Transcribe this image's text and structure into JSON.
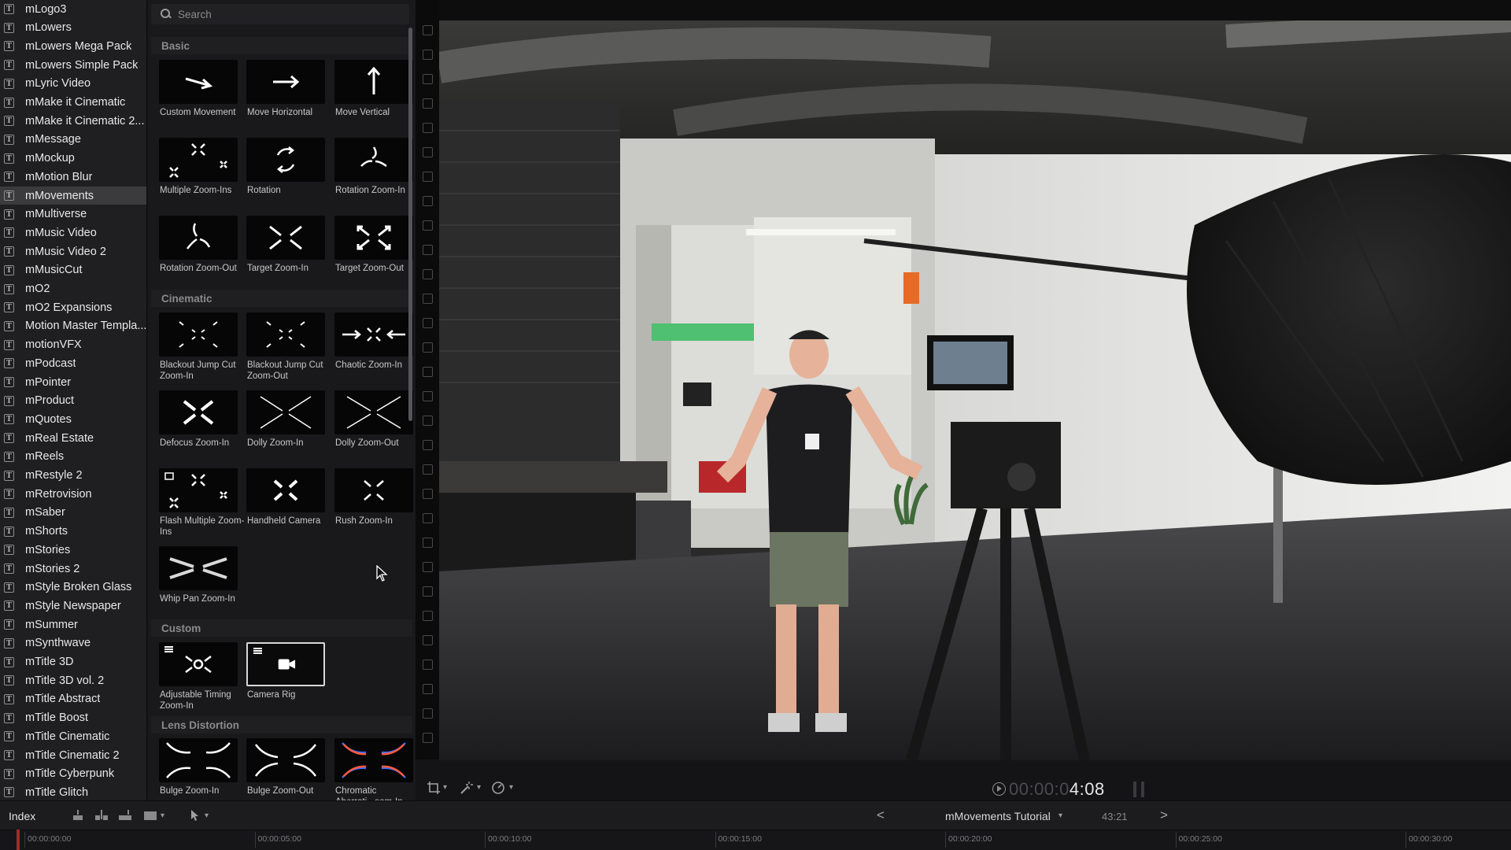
{
  "library": {
    "items": [
      {
        "label": "mLogo3"
      },
      {
        "label": "mLowers"
      },
      {
        "label": "mLowers Mega Pack"
      },
      {
        "label": "mLowers Simple Pack"
      },
      {
        "label": "mLyric Video"
      },
      {
        "label": "mMake it Cinematic"
      },
      {
        "label": "mMake it Cinematic 2..."
      },
      {
        "label": "mMessage"
      },
      {
        "label": "mMockup"
      },
      {
        "label": "mMotion Blur"
      },
      {
        "label": "mMovements"
      },
      {
        "label": "mMultiverse"
      },
      {
        "label": "mMusic Video"
      },
      {
        "label": "mMusic Video 2"
      },
      {
        "label": "mMusicCut"
      },
      {
        "label": "mO2"
      },
      {
        "label": "mO2 Expansions"
      },
      {
        "label": "Motion Master Templa..."
      },
      {
        "label": "motionVFX"
      },
      {
        "label": "mPodcast"
      },
      {
        "label": "mPointer"
      },
      {
        "label": "mProduct"
      },
      {
        "label": "mQuotes"
      },
      {
        "label": "mReal Estate"
      },
      {
        "label": "mReels"
      },
      {
        "label": "mRestyle 2"
      },
      {
        "label": "mRetrovision"
      },
      {
        "label": "mSaber"
      },
      {
        "label": "mShorts"
      },
      {
        "label": "mStories"
      },
      {
        "label": "mStories 2"
      },
      {
        "label": "mStyle Broken Glass"
      },
      {
        "label": "mStyle Newspaper"
      },
      {
        "label": "mSummer"
      },
      {
        "label": "mSynthwave"
      },
      {
        "label": "mTitle 3D"
      },
      {
        "label": "mTitle 3D vol. 2"
      },
      {
        "label": "mTitle Abstract"
      },
      {
        "label": "mTitle Boost"
      },
      {
        "label": "mTitle Cinematic"
      },
      {
        "label": "mTitle Cinematic 2"
      },
      {
        "label": "mTitle Cyberpunk"
      },
      {
        "label": "mTitle Glitch"
      }
    ],
    "selected": "mMovements"
  },
  "search": {
    "placeholder": "Search"
  },
  "sections": {
    "basic": "Basic",
    "cinematic": "Cinematic",
    "custom": "Custom",
    "lens_distortion": "Lens Distortion"
  },
  "tiles": {
    "custom_movement": "Custom Movement",
    "move_horizontal": "Move Horizontal",
    "move_vertical": "Move Vertical",
    "multiple_zoom_ins": "Multiple Zoom-Ins",
    "rotation": "Rotation",
    "rotation_zoom_in": "Rotation Zoom-In",
    "rotation_zoom_out": "Rotation Zoom-Out",
    "target_zoom_in": "Target Zoom-In",
    "target_zoom_out": "Target Zoom-Out",
    "blackout_jump_in": "Blackout Jump Cut Zoom-In",
    "blackout_jump_out": "Blackout Jump Cut Zoom-Out",
    "chaotic_zoom_in": "Chaotic Zoom-In",
    "defocus_zoom_in": "Defocus Zoom-In",
    "dolly_zoom_in": "Dolly Zoom-In",
    "dolly_zoom_out": "Dolly Zoom-Out",
    "flash_multiple": "Flash Multiple Zoom-Ins",
    "handheld_camera": "Handheld Camera",
    "rush_zoom_in": "Rush Zoom-In",
    "whip_pan_zoom_in": "Whip Pan Zoom-In",
    "adjustable_timing": "Adjustable Timing Zoom-In",
    "camera_rig": "Camera Rig",
    "bulge_zoom_in": "Bulge Zoom-In",
    "bulge_zoom_out": "Bulge Zoom-Out",
    "chromatic": "Chromatic Aberrati...oom-In"
  },
  "viewer": {
    "timecode_dim": "00:00:0",
    "timecode_bright": "4:08"
  },
  "bottom_bar": {
    "index": "Index",
    "project_name": "mMovements Tutorial",
    "project_duration": "43:21",
    "prev": "<",
    "next": ">"
  },
  "ruler": {
    "labels": [
      "00:00:00:00",
      "00:00:05:00",
      "00:00:10:00",
      "00:00:15:00",
      "00:00:20:00",
      "00:00:25:00",
      "00:00:30:00"
    ]
  },
  "colors": {
    "selection": "#3b3b3e",
    "panel": "#19191b",
    "playhead": "#9e2c2c"
  }
}
